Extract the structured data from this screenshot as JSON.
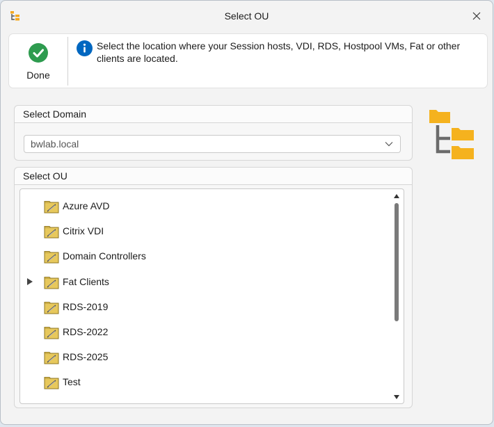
{
  "window": {
    "title": "Select OU",
    "app_icon": "ou-tree-icon",
    "close_icon": "close-icon"
  },
  "banner": {
    "done_label": "Done",
    "done_icon": "checkmark-circle-icon",
    "info_icon": "info-icon",
    "info_text": "Select the location where your Session hosts, VDI, RDS, Hostpool VMs, Fat or other clients are located."
  },
  "domain": {
    "header": "Select Domain",
    "selected": "bwlab.local"
  },
  "ou": {
    "header": "Select OU",
    "items": [
      {
        "label": "Azure AVD",
        "expandable": false
      },
      {
        "label": "Citrix VDI",
        "expandable": false
      },
      {
        "label": "Domain Controllers",
        "expandable": false
      },
      {
        "label": "Fat Clients",
        "expandable": true
      },
      {
        "label": "RDS-2019",
        "expandable": false
      },
      {
        "label": "RDS-2022",
        "expandable": false
      },
      {
        "label": "RDS-2025",
        "expandable": false
      },
      {
        "label": "Test",
        "expandable": false
      }
    ]
  },
  "colors": {
    "accent": "#0067c0",
    "success": "#2e9b4f",
    "folder": "#f5b21e"
  }
}
